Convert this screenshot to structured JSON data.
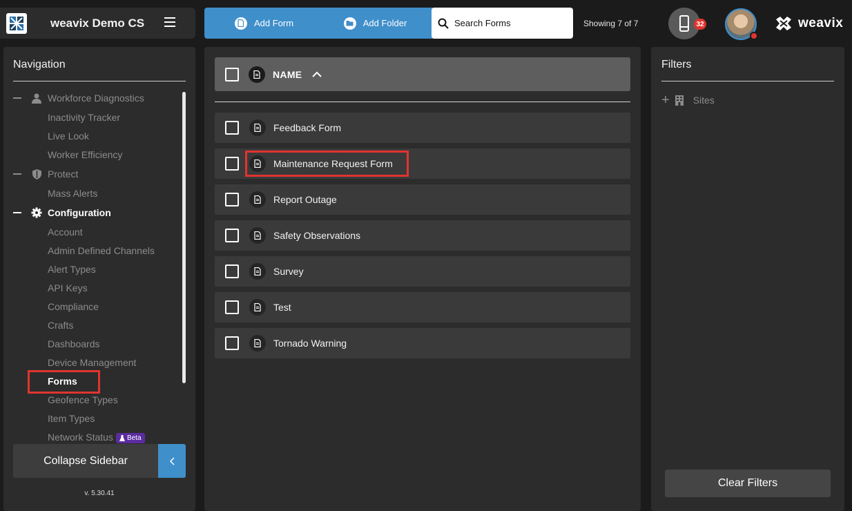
{
  "header": {
    "app_name": "weavix Demo CS",
    "add_form_label": "Add Form",
    "add_folder_label": "Add Folder",
    "search_placeholder": "Search Forms",
    "showing_text": "Showing 7 of 7",
    "device_badge_count": "32",
    "brand_wordmark": "weavix",
    "accent_color": "#3f8fca",
    "alert_color": "#e0342f"
  },
  "navigation": {
    "title": "Navigation",
    "groups": [
      {
        "label": "Workforce Diagnostics",
        "icon": "person-icon",
        "expanded": true,
        "active": false,
        "items": [
          "Inactivity Tracker",
          "Live Look",
          "Worker Efficiency"
        ]
      },
      {
        "label": "Protect",
        "icon": "shield-icon",
        "expanded": true,
        "active": false,
        "items": [
          "Mass Alerts"
        ]
      },
      {
        "label": "Configuration",
        "icon": "gear-icon",
        "expanded": true,
        "active": true,
        "items": [
          "Account",
          "Admin Defined Channels",
          "Alert Types",
          "API Keys",
          "Compliance",
          "Crafts",
          "Dashboards",
          "Device Management",
          "Forms",
          "Geofence Types",
          "Item Types",
          "Network Status"
        ]
      }
    ],
    "selected_item": "Forms",
    "beta_label": "Beta",
    "collapse_label": "Collapse Sidebar",
    "version": "v. 5.30.41"
  },
  "table": {
    "column_name": "NAME",
    "sort": "ascending",
    "rows": [
      "Feedback Form",
      "Maintenance Request Form",
      "Report Outage",
      "Safety Observations",
      "Survey",
      "Test",
      "Tornado Warning"
    ],
    "highlighted_row": "Maintenance Request Form"
  },
  "filters": {
    "title": "Filters",
    "site_label": "Sites",
    "clear_label": "Clear Filters"
  }
}
